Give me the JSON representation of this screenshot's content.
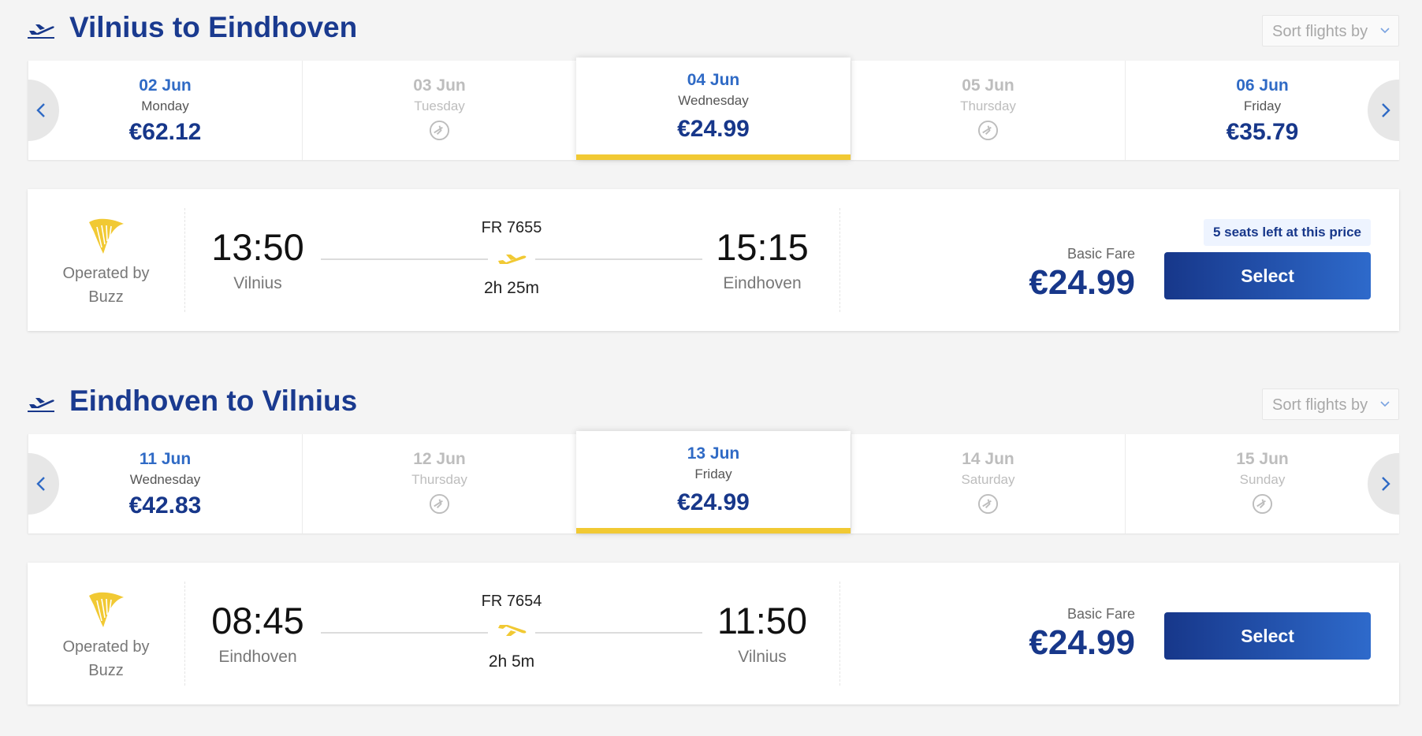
{
  "colors": {
    "brand_blue": "#17378a",
    "link_blue": "#2f6ac5",
    "accent_yellow": "#f1c933",
    "button_gradient_end": "#2e6acb"
  },
  "outbound": {
    "title": "Vilnius to Eindhoven",
    "sort_label": "Sort flights by",
    "dates": [
      {
        "date": "02 Jun",
        "day": "Monday",
        "price": "€62.12",
        "available": true
      },
      {
        "date": "03 Jun",
        "day": "Tuesday",
        "price": "",
        "available": false
      },
      {
        "date": "04 Jun",
        "day": "Wednesday",
        "price": "€24.99",
        "available": true,
        "selected": true
      },
      {
        "date": "05 Jun",
        "day": "Thursday",
        "price": "",
        "available": false
      },
      {
        "date": "06 Jun",
        "day": "Friday",
        "price": "€35.79",
        "available": true
      }
    ],
    "flight": {
      "operated_label": "Operated by",
      "operator": "Buzz",
      "dep_time": "13:50",
      "dep_city": "Vilnius",
      "flight_no": "FR 7655",
      "duration": "2h 25m",
      "arr_time": "15:15",
      "arr_city": "Eindhoven",
      "seats_badge": "5 seats left at this price",
      "fare_label": "Basic Fare",
      "fare_price": "€24.99",
      "select_label": "Select"
    }
  },
  "inbound": {
    "title": "Eindhoven to Vilnius",
    "sort_label": "Sort flights by",
    "dates": [
      {
        "date": "11 Jun",
        "day": "Wednesday",
        "price": "€42.83",
        "available": true
      },
      {
        "date": "12 Jun",
        "day": "Thursday",
        "price": "",
        "available": false
      },
      {
        "date": "13 Jun",
        "day": "Friday",
        "price": "€24.99",
        "available": true,
        "selected": true
      },
      {
        "date": "14 Jun",
        "day": "Saturday",
        "price": "",
        "available": false
      },
      {
        "date": "15 Jun",
        "day": "Sunday",
        "price": "",
        "available": false
      }
    ],
    "flight": {
      "operated_label": "Operated by",
      "operator": "Buzz",
      "dep_time": "08:45",
      "dep_city": "Eindhoven",
      "flight_no": "FR 7654",
      "duration": "2h 5m",
      "arr_time": "11:50",
      "arr_city": "Vilnius",
      "fare_label": "Basic Fare",
      "fare_price": "€24.99",
      "select_label": "Select"
    }
  }
}
